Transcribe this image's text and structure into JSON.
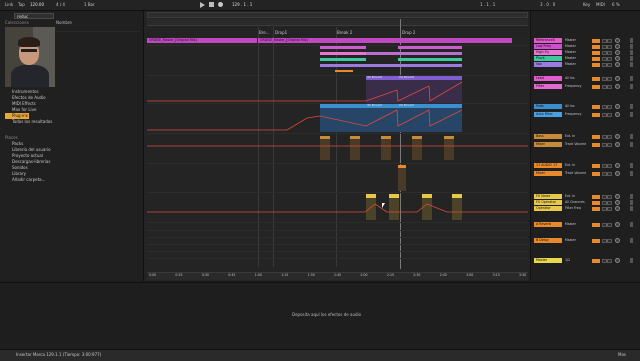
{
  "topbar": {
    "link_label": "Link",
    "tap_label": "Tap",
    "tempo": "120.00",
    "time_sig": "4 / 4",
    "quantize": "1 Bar",
    "position": "129 . 1 . 1",
    "loop_start": "1 . 1 . 1",
    "loop_length": "3 . 0 . 0",
    "key_label": "Key",
    "midi_label": "MIDI",
    "cpu": "6 %"
  },
  "browser": {
    "search_value": "reduc",
    "search_placeholder": "Buscar",
    "header_label": "Nombre",
    "categories_title": "Colecciones",
    "categories": [
      {
        "label": "Instrumentos",
        "active": false
      },
      {
        "label": "Efectos de Audio",
        "active": false
      },
      {
        "label": "MIDI Effects",
        "active": false
      },
      {
        "label": "Max for Live",
        "active": false
      },
      {
        "label": "Plug-ins",
        "active": true
      },
      {
        "label": "Todos los resultados",
        "active": false
      }
    ],
    "places_title": "Places",
    "places": [
      {
        "label": "Packs"
      },
      {
        "label": "Librería del usuario"
      },
      {
        "label": "Proyecto actual"
      },
      {
        "label": "Descargas-librerías"
      },
      {
        "label": "Sonidos"
      },
      {
        "label": "Library"
      },
      {
        "label": "Añadir carpeta..."
      }
    ]
  },
  "timeline": {
    "locators": [
      {
        "label": "Bre..."
      },
      {
        "label": "Drop1"
      },
      {
        "label": "Break 2"
      },
      {
        "label": "Drop 2"
      }
    ],
    "bottom_times": [
      "0:00",
      "0:15",
      "0:30",
      "0:45",
      "1:00",
      "1:15",
      "1:30",
      "1:45",
      "2:00",
      "2:15",
      "2:30",
      "2:45",
      "3:00",
      "3:15",
      "3:30"
    ],
    "clip_names": {
      "master_a": "ORDISE_Master_[Original Mix]",
      "master_b": "ORDISE_Master_[Original Mix]",
      "aux_a": "32 Drum2",
      "aux_b": "24 Drum2",
      "aux_c": "32 Drum2",
      "aux_d": "24 Drum2",
      "auto_a": "Auto"
    }
  },
  "mixer": {
    "tracks": [
      {
        "name": "ReferenceX",
        "color": "#e05ad0",
        "io": "Master",
        "vol": "0",
        "pan": "C"
      },
      {
        "name": "Low Freq",
        "color": "#d04fd0",
        "io": "Master",
        "vol": "0",
        "pan": "C"
      },
      {
        "name": "High Fq",
        "color": "#e874d6",
        "io": "Master",
        "vol": "0",
        "pan": "C"
      },
      {
        "name": "Pluck",
        "color": "#3cc9a0",
        "io": "Master",
        "vol": "0",
        "pan": "C"
      },
      {
        "name": "Vox",
        "color": "#9c7ae0",
        "io": "Master",
        "vol": "0",
        "pan": "C"
      },
      {
        "name": "Lead",
        "color": "#e05ad0",
        "io": "All Ins",
        "vol": "0",
        "pan": "C"
      },
      {
        "name": "Filter",
        "color": "#e06ad0",
        "io": "Frequency",
        "vol": "0",
        "pan": "C"
      },
      {
        "name": "Pads",
        "color": "#3a8fd0",
        "io": "All Ins",
        "vol": "0",
        "pan": "C"
      },
      {
        "name": "Auto Filter",
        "color": "#4aa0e0",
        "io": "Frequency",
        "vol": "0",
        "pan": "C"
      },
      {
        "name": "Bass",
        "color": "#c98a3a",
        "io": "Ext. In",
        "vol": "0",
        "pan": "C"
      },
      {
        "name": "Mixer",
        "color": "#c98a3a",
        "io": "Track Volume",
        "vol": "0",
        "pan": "C"
      },
      {
        "name": "17 AUDIO 17",
        "color": "#e8892b",
        "io": "Ext. In",
        "vol": "0",
        "pan": "C"
      },
      {
        "name": "Mixer",
        "color": "#e8892b",
        "io": "Track Volume",
        "vol": "0",
        "pan": "C"
      },
      {
        "name": "FX Noise",
        "color": "#e8c84a",
        "io": "Ext. In",
        "vol": "0",
        "pan": "C"
      },
      {
        "name": "FX Operator",
        "color": "#e8c84a",
        "io": "All Channels",
        "vol": "0",
        "pan": "C"
      },
      {
        "name": "Operator",
        "color": "#e8c84a",
        "io": "Filter Freq",
        "vol": "0",
        "pan": "C"
      },
      {
        "name": "A Reverb",
        "color": "#e88a2b",
        "io": "Master",
        "vol": "0",
        "pan": "C"
      },
      {
        "name": "B Delay",
        "color": "#e88a2b",
        "io": "Master",
        "vol": "0",
        "pan": "C"
      },
      {
        "name": "Master",
        "color": "#e8d84a",
        "io": "1/2",
        "vol": "0",
        "pan": "C"
      }
    ],
    "sends_labels": [
      "Reverb",
      "Delay",
      "Mixer",
      "Groups"
    ]
  },
  "device": {
    "drop_hint": "Deposita aquí los efectos de audio"
  },
  "statusbar": {
    "text": "Insertar Marca 129.1.1 (Tiempo: 3:00:977)",
    "right_label": "Mas"
  },
  "colors": {
    "pink": "#e05ad0",
    "blue": "#3a8fd0",
    "orange": "#e8892b",
    "yellow": "#e8c84a",
    "teal": "#3cc9a0"
  }
}
